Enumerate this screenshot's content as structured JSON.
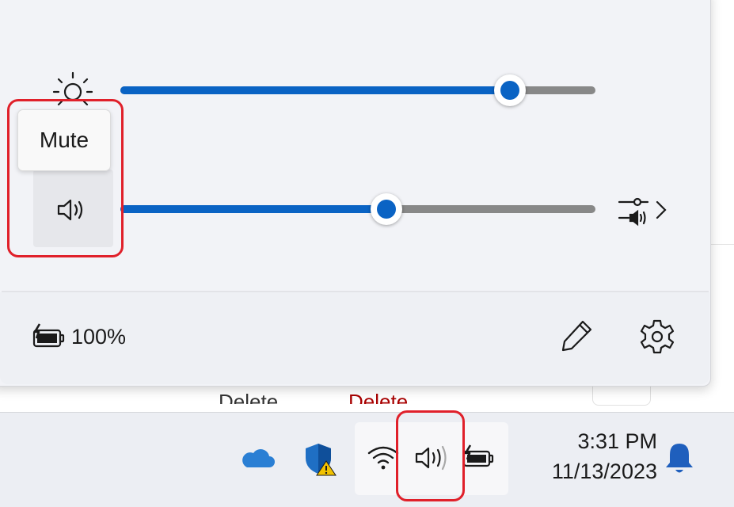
{
  "flyout": {
    "brightness": {
      "icon": "brightness-icon",
      "level_percent": 82
    },
    "volume": {
      "icon": "speaker-icon",
      "level_percent": 56,
      "tooltip": "Mute"
    },
    "audio_output_icon": "audio-output-settings-icon",
    "battery": {
      "icon": "battery-charging-icon",
      "label": "100%"
    },
    "edit_icon": "pencil-icon",
    "settings_icon": "gear-icon"
  },
  "background": {
    "text_left": "Delete",
    "text_right": "Delete"
  },
  "taskbar": {
    "tray_icons": [
      "onedrive-icon",
      "defender-warning-icon",
      "wifi-icon",
      "speaker-icon",
      "battery-charging-icon"
    ],
    "time": "3:31 PM",
    "date": "11/13/2023",
    "notifications_icon": "bell-icon"
  },
  "colors": {
    "accent": "#0a63c4",
    "highlight": "#e0202a",
    "onedrive": "#2a7fd4",
    "bell": "#1f5fbd"
  }
}
